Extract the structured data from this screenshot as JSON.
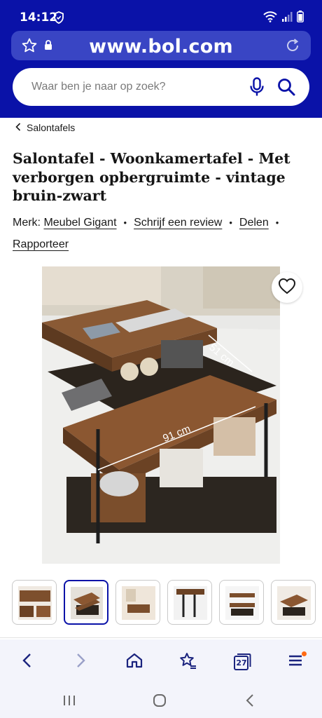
{
  "status_bar": {
    "time": "14:12",
    "icons": [
      "shield-icon",
      "wifi-icon",
      "signal-icon",
      "battery-icon"
    ]
  },
  "browser": {
    "url": "www.bol.com",
    "icons": [
      "star-icon",
      "lock-icon",
      "reload-icon"
    ]
  },
  "search": {
    "placeholder": "Waar ben je naar op zoek?",
    "icons": [
      "mic-icon",
      "search-icon"
    ]
  },
  "breadcrumb": {
    "label": "Salontafels",
    "icon": "chevron-left-icon"
  },
  "product": {
    "title": "Salontafel - Woonkamertafel - Met verborgen opbergruimte - vintage bruin-zwart",
    "brand_prefix": "Merk:",
    "brand": "Meubel Gigant",
    "write_review": "Schrijf een review",
    "share": "Delen",
    "report": "Rapporteer",
    "separator": "•"
  },
  "image": {
    "dim_depth": "51 cm",
    "dim_width": "91 cm",
    "favorite_icon": "heart-icon"
  },
  "thumbnails": {
    "count": 6,
    "active_index": 1
  },
  "toolbar": {
    "tab_count": "27",
    "icons": [
      "back-icon",
      "forward-icon",
      "home-icon",
      "bookmark-star-icon",
      "tabs-icon",
      "menu-icon"
    ]
  },
  "colors": {
    "brand_blue": "#0a12a8",
    "url_bar": "#3945c4",
    "notification": "#ff6a13"
  }
}
